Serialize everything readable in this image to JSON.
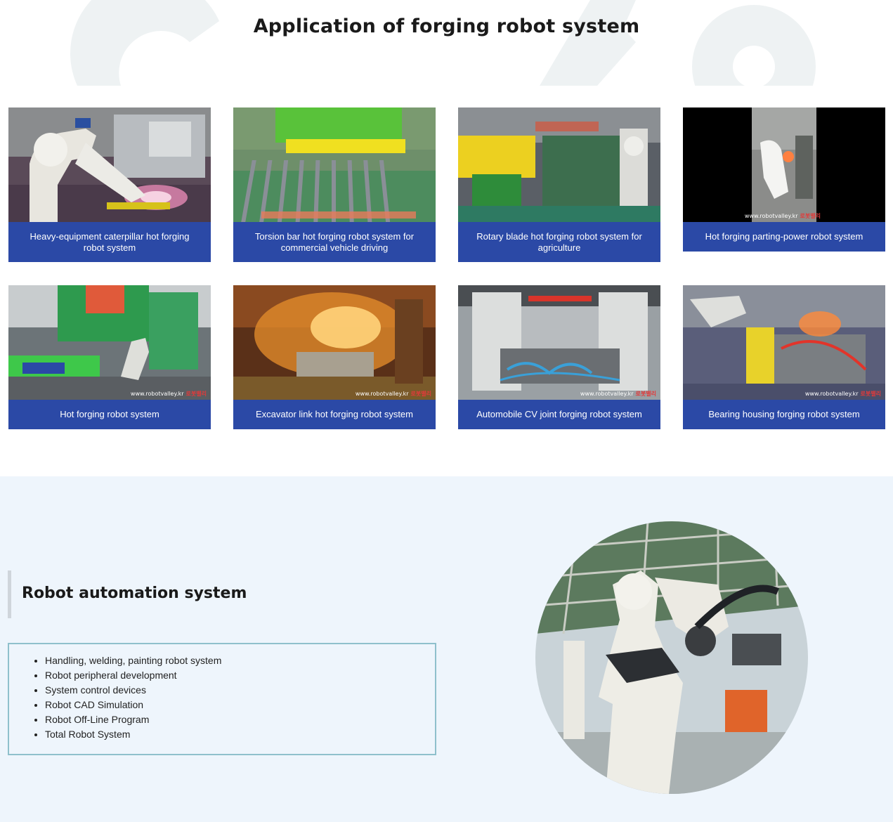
{
  "section_title": "Application of forging robot system",
  "cards": [
    {
      "caption": "Heavy-equipment caterpillar hot forging robot system",
      "watermark": ""
    },
    {
      "caption": "Torsion bar hot forging robot system for commercial vehicle driving",
      "watermark": ""
    },
    {
      "caption": "Rotary blade hot forging robot system for agriculture",
      "watermark": ""
    },
    {
      "caption": "Hot forging parting-power robot system",
      "watermark": "www.robotvalley.kr",
      "logo": "로봇밸리"
    },
    {
      "caption": "Hot forging robot system",
      "watermark": "www.robotvalley.kr",
      "logo": "로봇밸리"
    },
    {
      "caption": "Excavator link hot forging robot system",
      "watermark": "www.robotvalley.kr",
      "logo": "로봇밸리"
    },
    {
      "caption": "Automobile CV joint forging robot system",
      "watermark": "www.robotvalley.kr",
      "logo": "로봇밸리"
    },
    {
      "caption": "Bearing housing forging robot system",
      "watermark": "www.robotvalley.kr",
      "logo": "로봇밸리"
    }
  ],
  "automation": {
    "title": "Robot automation system",
    "items": [
      "Handling, welding, painting robot system",
      "Robot peripheral development",
      "System control devices",
      "Robot CAD Simulation",
      "Robot Off-Line Program",
      "Total Robot System"
    ]
  },
  "colors": {
    "caption_bg": "#2b49a6",
    "bottom_bg": "#eef5fc",
    "list_border": "#8fc0cc"
  }
}
